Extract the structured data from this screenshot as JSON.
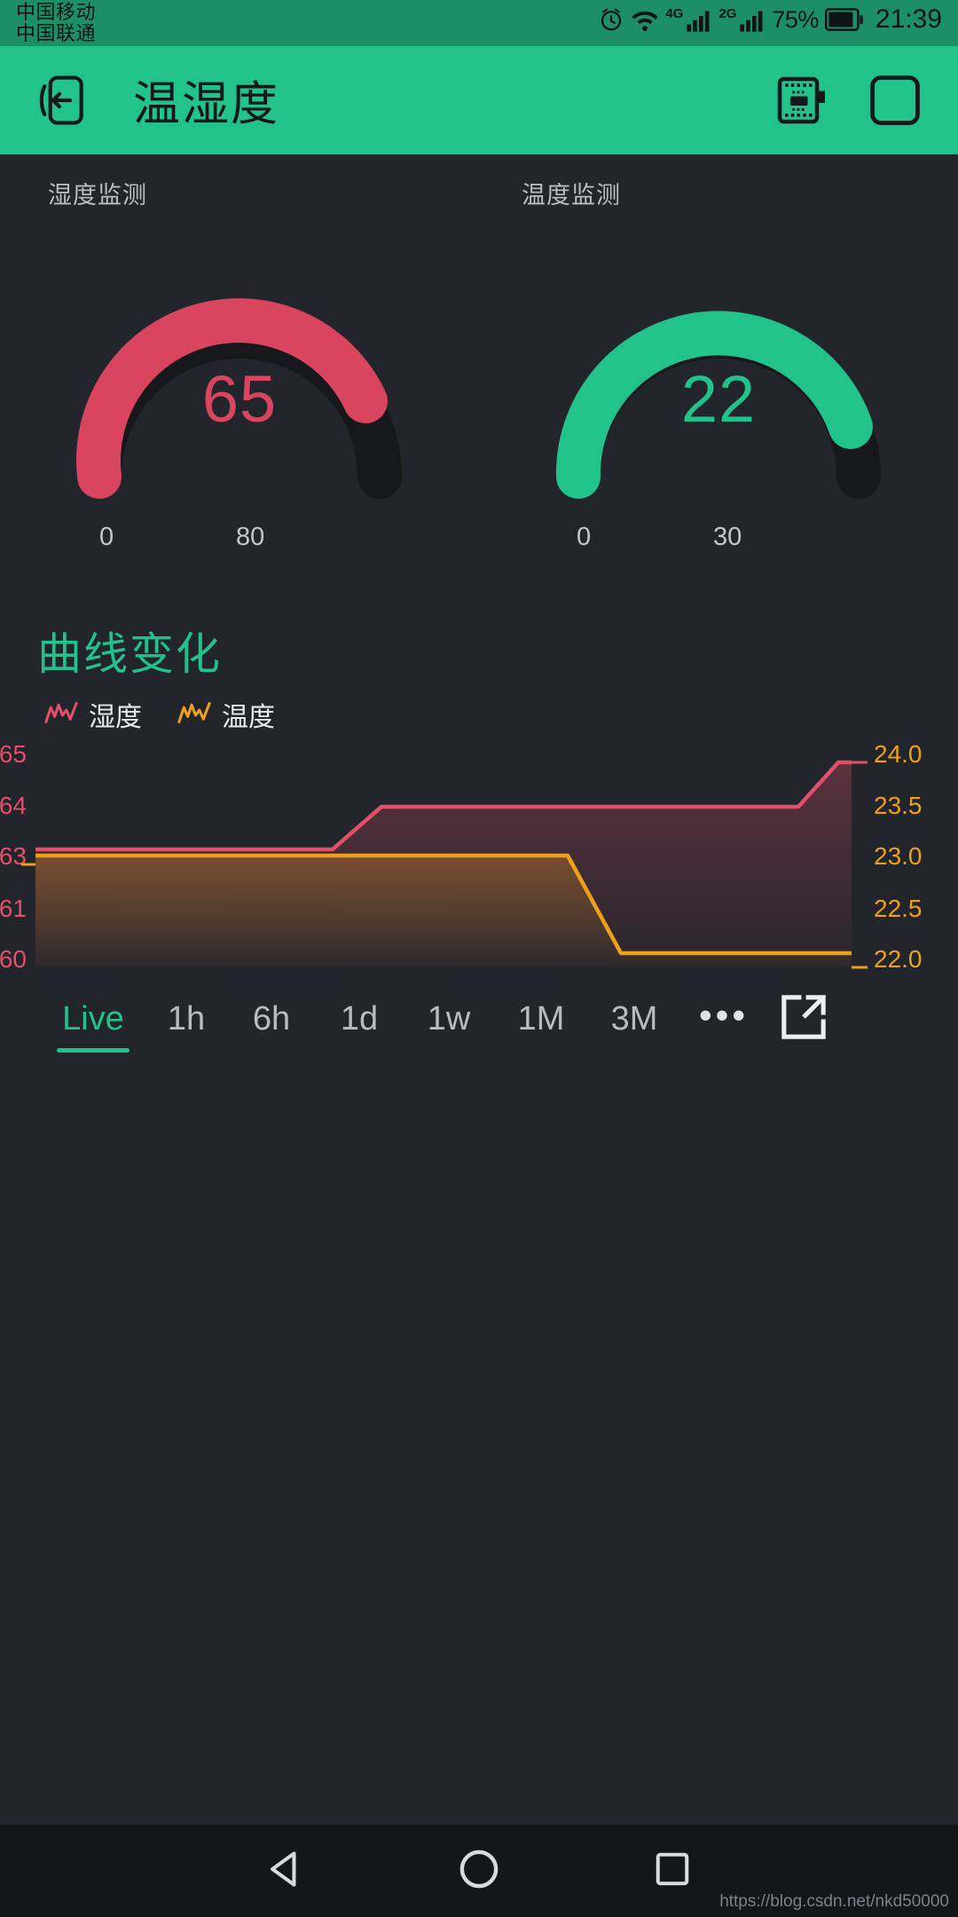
{
  "statusbar": {
    "carriers": [
      "中国移动",
      "中国联通"
    ],
    "icons": [
      "alarm-icon",
      "wifi-icon",
      "signal-4g-icon",
      "signal-2g-icon",
      "battery-icon"
    ],
    "network_labels": [
      "4G",
      "2G"
    ],
    "battery_percent": "75%",
    "clock": "21:39"
  },
  "appbar": {
    "back_icon": "exit-app-icon",
    "title": "温湿度",
    "chip_icon": "chip-board-icon",
    "square_icon": "square-outline-icon",
    "bg_color": "#22c38a"
  },
  "gauges": [
    {
      "label": "湿度监测",
      "value": "65",
      "min": "0",
      "max": "80",
      "min_num": 0,
      "max_num": 80,
      "value_num": 65,
      "color": "#d9455f",
      "track_color": "#16181c"
    },
    {
      "label": "温度监测",
      "value": "22",
      "min": "0",
      "max": "30",
      "min_num": 0,
      "max_num": 30,
      "value_num": 22,
      "color": "#22c38a",
      "track_color": "#16181c"
    }
  ],
  "chart_section": {
    "title": "曲线变化",
    "legend": [
      {
        "label": "湿度",
        "color": "#e0506a",
        "icon": "spark-line-icon"
      },
      {
        "label": "温度",
        "color": "#eda019",
        "icon": "spark-line-icon"
      }
    ]
  },
  "chart_data": {
    "type": "line",
    "title": "曲线变化",
    "xlabel": "",
    "grid": false,
    "legend_position": "top-left",
    "left_axis": {
      "name": "湿度",
      "color": "#e0506a",
      "tick_labels": [
        "65",
        "64",
        "63",
        "61",
        "60"
      ],
      "ticks": [
        65,
        64,
        63,
        61,
        60
      ],
      "ylim": [
        60,
        65
      ]
    },
    "right_axis": {
      "name": "温度",
      "color": "#eda019",
      "tick_labels": [
        "24.0",
        "23.5",
        "23.0",
        "22.5",
        "22.0"
      ],
      "ticks": [
        24.0,
        23.5,
        23.0,
        22.5,
        22.0
      ],
      "ylim": [
        22.0,
        24.0
      ]
    },
    "series": [
      {
        "name": "湿度",
        "color": "#e0506a",
        "axis": "left",
        "x": [
          0,
          0.4,
          0.46,
          0.92,
          0.97,
          1.0
        ],
        "values": [
          63.0,
          63.0,
          64.0,
          64.0,
          65.0,
          65.0
        ]
      },
      {
        "name": "温度",
        "color": "#eda019",
        "axis": "right",
        "x": [
          0,
          0.64,
          0.7,
          1.0
        ],
        "values": [
          23.0,
          23.0,
          22.0,
          22.0
        ]
      }
    ]
  },
  "tabs": {
    "items": [
      {
        "label": "Live",
        "active": true
      },
      {
        "label": "1h",
        "active": false
      },
      {
        "label": "6h",
        "active": false
      },
      {
        "label": "1d",
        "active": false
      },
      {
        "label": "1w",
        "active": false
      },
      {
        "label": "1M",
        "active": false
      },
      {
        "label": "3M",
        "active": false
      }
    ],
    "more_label": "•••",
    "export_icon": "export-fullscreen-icon"
  },
  "navbar": {
    "back_icon": "nav-back-triangle-icon",
    "home_icon": "nav-home-circle-icon",
    "recents_icon": "nav-recents-square-icon"
  },
  "watermark": "https://blog.csdn.net/nkd50000"
}
